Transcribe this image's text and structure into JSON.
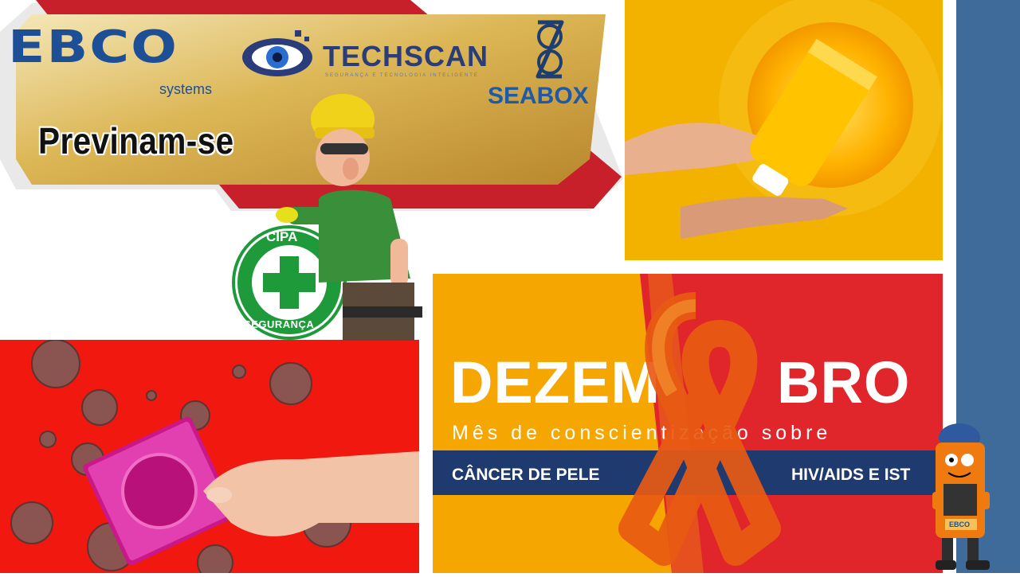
{
  "banner": {
    "ebco_logo": "EBCO",
    "ebco_sub": "systems",
    "techscan_logo": "TECHSCAN",
    "techscan_sub": "SEGURANÇA E TECNOLOGIA INTELIGENTE",
    "seabox_logo": "SEABOX",
    "headline": "Previnam-se"
  },
  "cipa": {
    "top_text": "CIPA",
    "bottom_text": "SEGURANÇA"
  },
  "campaign": {
    "title_left": "DEZEM",
    "title_right": "BRO",
    "subtitle": "Mês de conscientização sobre",
    "band_left": "CÂNCER DE PELE",
    "band_right": "HIV/AIDS E IST"
  },
  "mascot": {
    "badge": "EBCO"
  },
  "colors": {
    "side_strip": "#3f6b9a",
    "banner_gold": "#d9b24a",
    "banner_red": "#c8202a",
    "ebco_blue": "#1d4f97",
    "campaign_orange": "#f5a000",
    "campaign_red": "#e0252b",
    "band_navy": "#1f3a6e",
    "virus_red": "#f0180f",
    "cipa_green": "#1f9a3a"
  }
}
